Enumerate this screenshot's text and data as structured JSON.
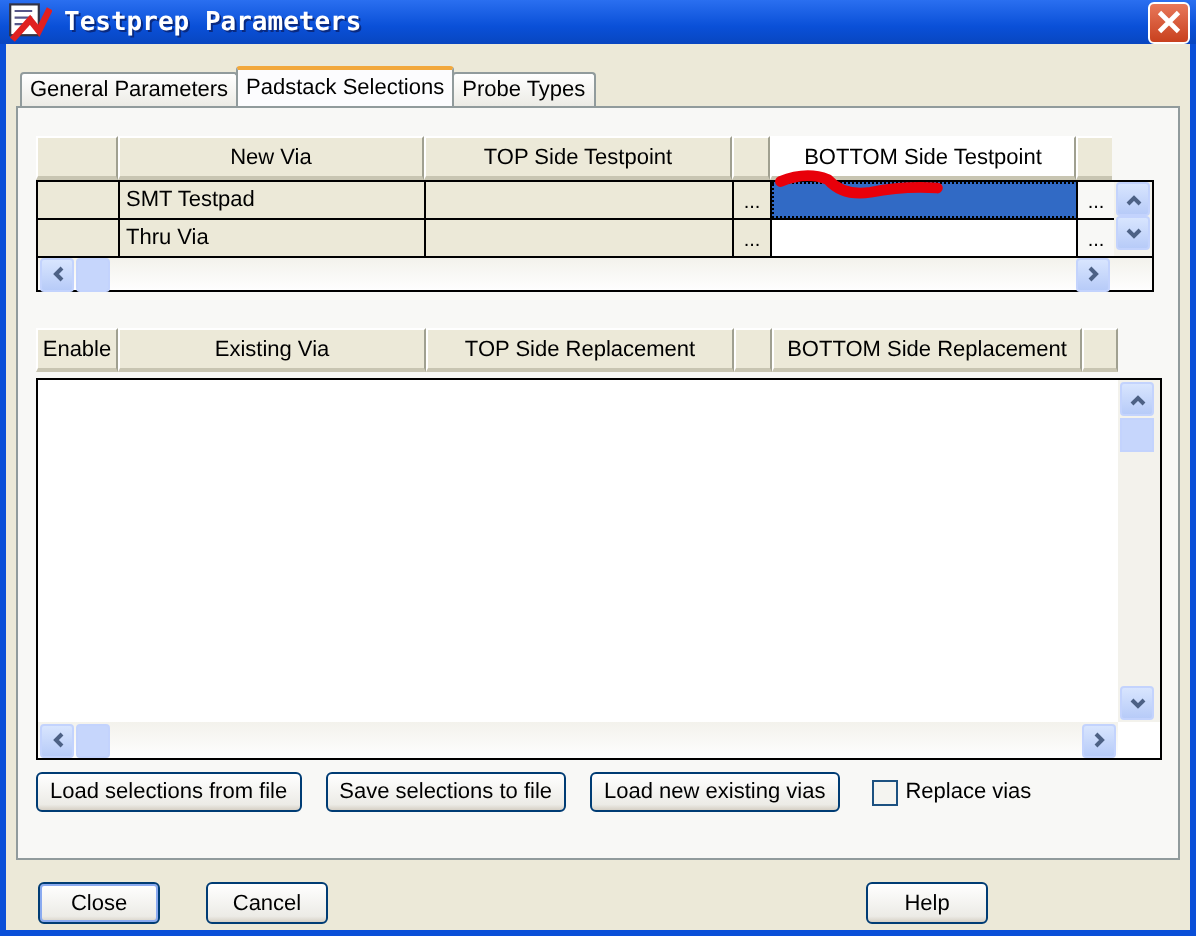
{
  "window": {
    "title": "Testprep Parameters"
  },
  "tabs": [
    {
      "label": "General Parameters",
      "selected": false
    },
    {
      "label": "Padstack Selections",
      "selected": true
    },
    {
      "label": "Probe Types",
      "selected": false
    }
  ],
  "new_via_table": {
    "columns": [
      "New Via",
      "TOP Side Testpoint",
      "BOTTOM Side Testpoint"
    ],
    "rows": [
      {
        "new_via": "SMT Testpad",
        "top_button": "...",
        "bottom_button": "...",
        "selected": true
      },
      {
        "new_via": "Thru Via",
        "top_button": "...",
        "bottom_button": "...",
        "selected": false
      }
    ]
  },
  "existing_via_table": {
    "columns": [
      "Enable",
      "Existing Via",
      "TOP Side Replacement",
      "BOTTOM Side Replacement"
    ]
  },
  "buttons": [
    "Load selections from file",
    "Save selections to file",
    "Load new existing vias"
  ],
  "replace_vias": {
    "label": "Replace vias",
    "checked": false
  },
  "dialog_buttons": [
    {
      "label": "Close",
      "kind": "default"
    },
    {
      "label": "Cancel",
      "kind": "normal"
    },
    {
      "label": "Help",
      "kind": "normal"
    }
  ]
}
